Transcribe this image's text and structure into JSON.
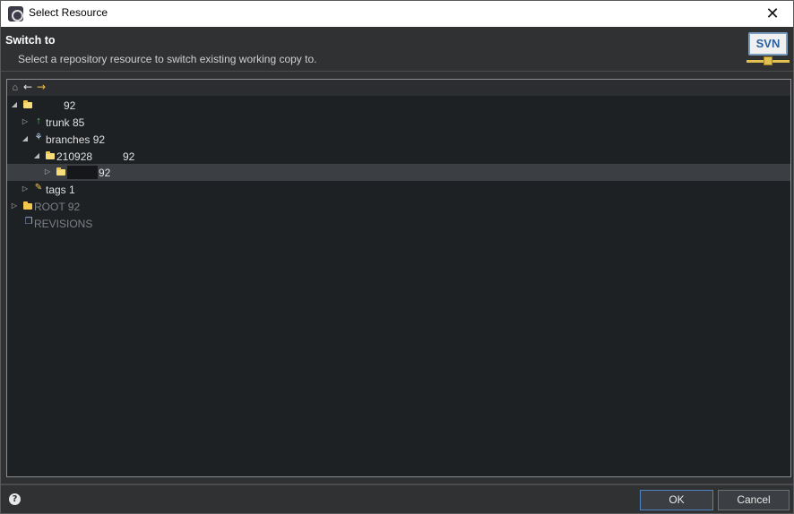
{
  "window": {
    "title": "Select Resource",
    "close_glyph": "✕"
  },
  "header": {
    "title": "Switch to",
    "description": "Select a repository resource to switch existing working copy to.",
    "badge_text": "SVN"
  },
  "toolbar": {
    "home_glyph": "⌂",
    "back_glyph": "←",
    "forward_glyph": "→"
  },
  "tree": {
    "rows": [
      {
        "label": "92",
        "icon": "folder-icon"
      },
      {
        "label": "trunk 85",
        "icon": "trunk-icon"
      },
      {
        "label": "branches 92",
        "icon": "branches-icon"
      },
      {
        "label_prefix": "210928",
        "label_suffix": "92",
        "icon": "folder-icon"
      },
      {
        "label": "92",
        "icon": "folder-icon"
      },
      {
        "label": "tags 1",
        "icon": "tags-icon"
      },
      {
        "label": "ROOT 92",
        "icon": "folder-icon"
      },
      {
        "label": "REVISIONS",
        "icon": "revisions-icon"
      }
    ]
  },
  "footer": {
    "help_glyph": "?",
    "ok_label": "OK",
    "cancel_label": "Cancel"
  },
  "colors": {
    "accent": "#4f84c4",
    "folder": "#f2c94c",
    "trunk": "#5fcf6a"
  }
}
